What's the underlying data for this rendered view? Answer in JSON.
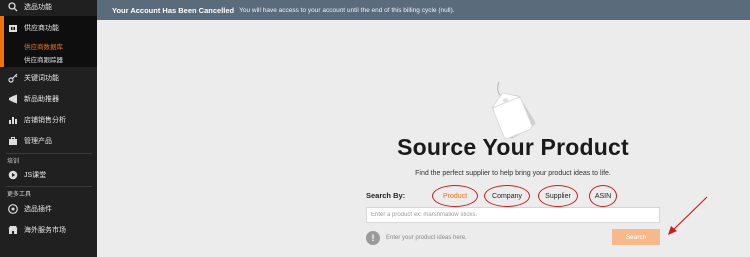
{
  "sidebar": {
    "items": [
      {
        "label": "选品功能",
        "icon": "search-icon"
      },
      {
        "label": "供应商功能",
        "icon": "supplier-icon"
      },
      {
        "label": "关键词功能",
        "icon": "key-icon"
      },
      {
        "label": "新品助推器",
        "icon": "megaphone-icon"
      },
      {
        "label": "店铺销售分析",
        "icon": "bar-chart-icon"
      },
      {
        "label": "管理产品",
        "icon": "briefcase-icon"
      },
      {
        "label": "JS课堂",
        "icon": "play-icon"
      },
      {
        "label": "选品插件",
        "icon": "puzzle-icon"
      },
      {
        "label": "海外服务市场",
        "icon": "store-icon"
      }
    ],
    "subitems": [
      "供应商数据库",
      "供应商跟踪器"
    ],
    "sections": [
      "培训",
      "更多工具"
    ],
    "accent": "#f0720e"
  },
  "banner": {
    "title": "Your Account Has Been Cancelled",
    "message": "You will have access to your account until the end of this billing cycle (null)."
  },
  "main": {
    "title": "Source Your Product",
    "subtitle": "Find the perfect supplier to help bring your product ideas to life.",
    "search_by_label": "Search By:",
    "options": [
      {
        "label": "Product",
        "selected": true
      },
      {
        "label": "Company",
        "selected": false
      },
      {
        "label": "Supplier",
        "selected": false
      },
      {
        "label": "ASIN",
        "selected": false
      }
    ],
    "search_placeholder": "Enter a product ex: marshmallow sticks.",
    "hint": "Enter your product ideas here.",
    "search_button": "Search"
  }
}
